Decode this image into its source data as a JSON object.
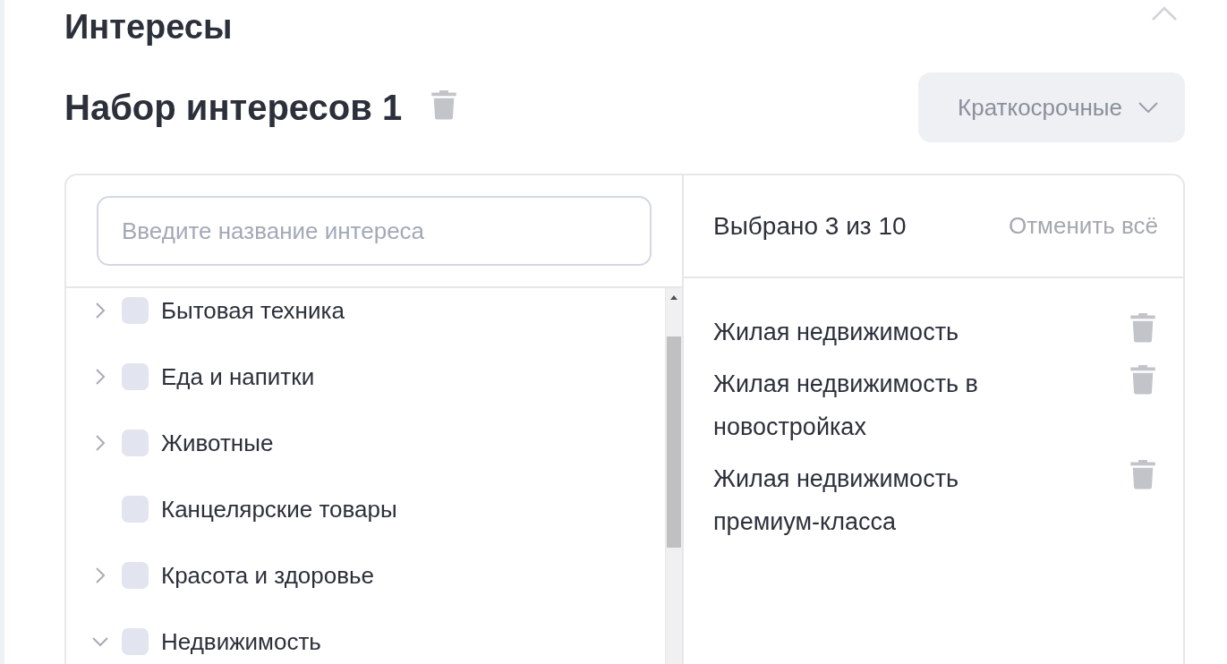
{
  "section": {
    "title": "Интересы",
    "collapse_expanded": true
  },
  "set": {
    "title": "Набор интересов 1",
    "period": "Краткосрочные"
  },
  "search": {
    "placeholder": "Введите название интереса"
  },
  "tree": [
    {
      "label": "Бытовая техника",
      "expanded": false,
      "checked": false
    },
    {
      "label": "Еда и напитки",
      "expanded": false,
      "checked": false
    },
    {
      "label": "Животные",
      "expanded": false,
      "checked": false
    },
    {
      "label": "Канцелярские товары",
      "checked": false
    },
    {
      "label": "Красота и здоровье",
      "expanded": false,
      "checked": false
    },
    {
      "label": "Недвижимость",
      "expanded": true,
      "checked": false
    }
  ],
  "selected": {
    "summary": "Выбрано 3 из 10",
    "clear_all": "Отменить всё",
    "items": [
      "Жилая недвижимость",
      "Жилая недвижимость в новостройках",
      "Жилая недвижимость премиум-класса"
    ]
  }
}
